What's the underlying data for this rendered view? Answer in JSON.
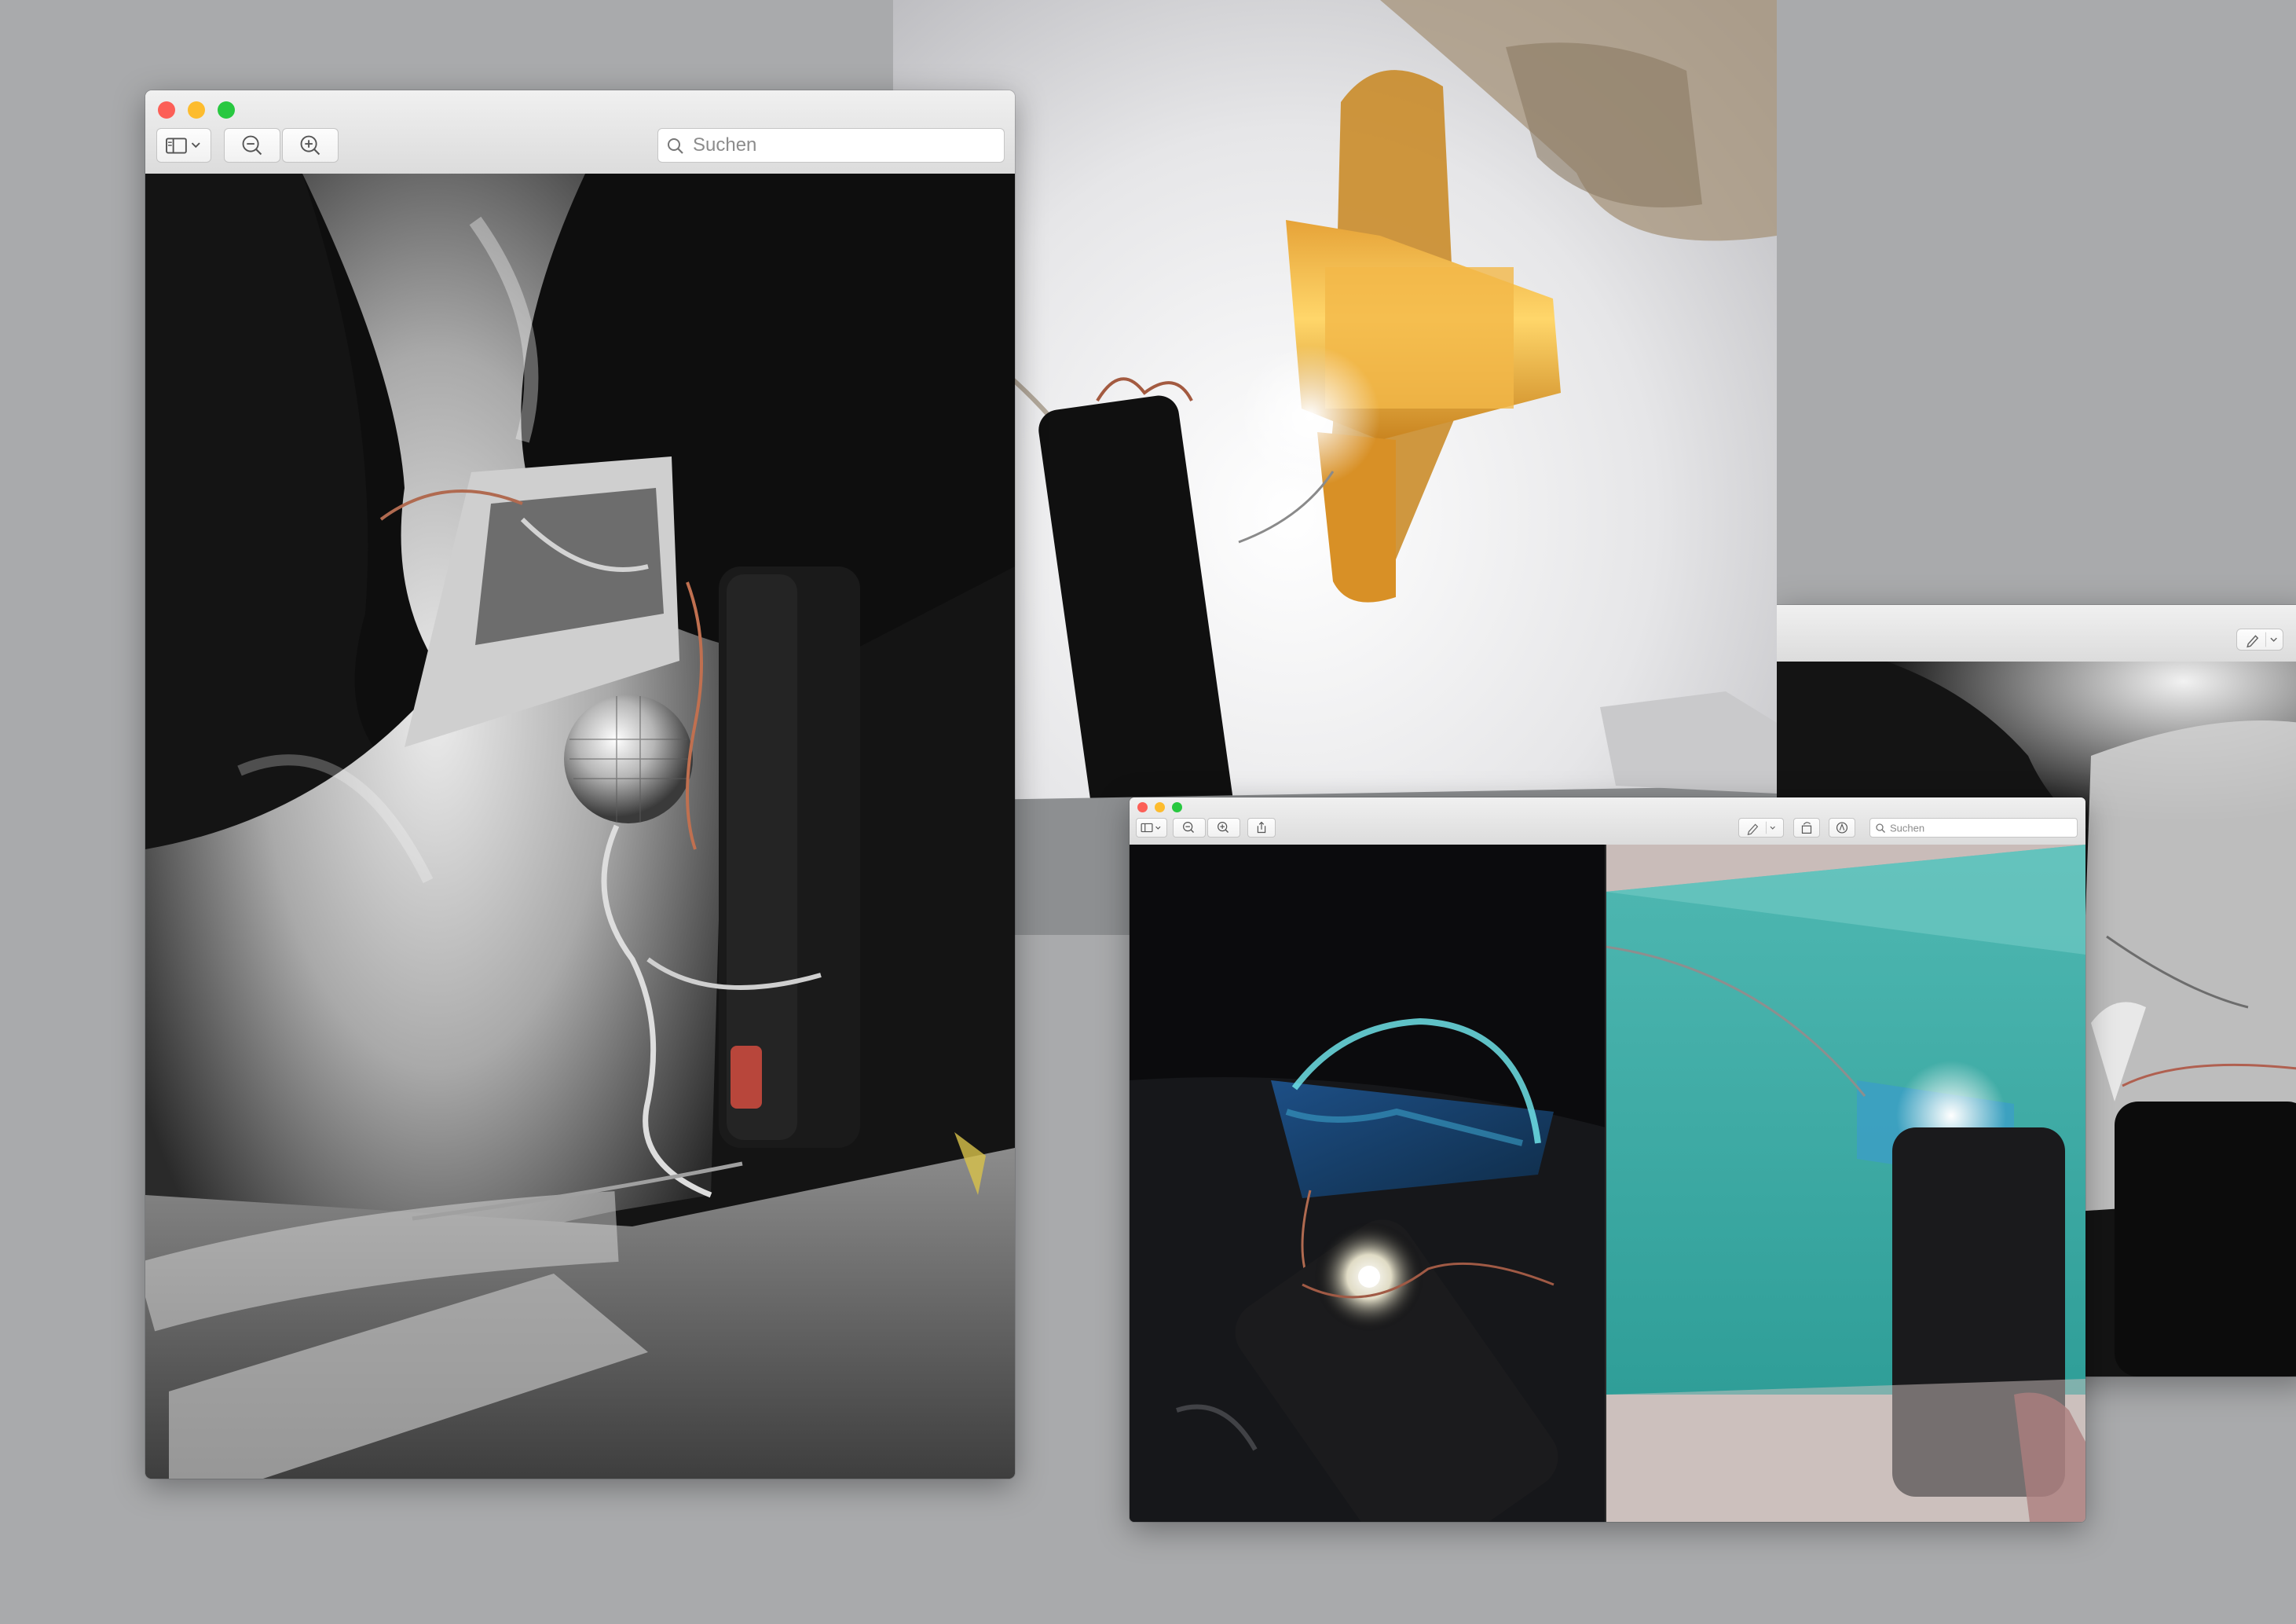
{
  "windows": {
    "main": {
      "search_placeholder": "Suchen",
      "toolbar": {
        "sidebar_toggle": "sidebar-icon",
        "zoom_out": "zoom-out-icon",
        "zoom_in": "zoom-in-icon",
        "search": "search-icon"
      }
    },
    "small": {
      "search_placeholder": "Suchen",
      "toolbar": {
        "sidebar_toggle": "sidebar-icon",
        "zoom_out": "zoom-out-icon",
        "zoom_in": "zoom-in-icon",
        "share": "share-icon",
        "markup": "pen-icon",
        "rotate": "rotate-icon",
        "annotate": "markup-circle-icon",
        "search": "search-icon"
      }
    },
    "right": {
      "toolbar": {
        "markup": "pen-icon"
      }
    }
  },
  "colors": {
    "close": "#fc5f57",
    "minimize": "#fdbc2e",
    "zoom": "#28c840",
    "desktop": "#a9aaac"
  }
}
